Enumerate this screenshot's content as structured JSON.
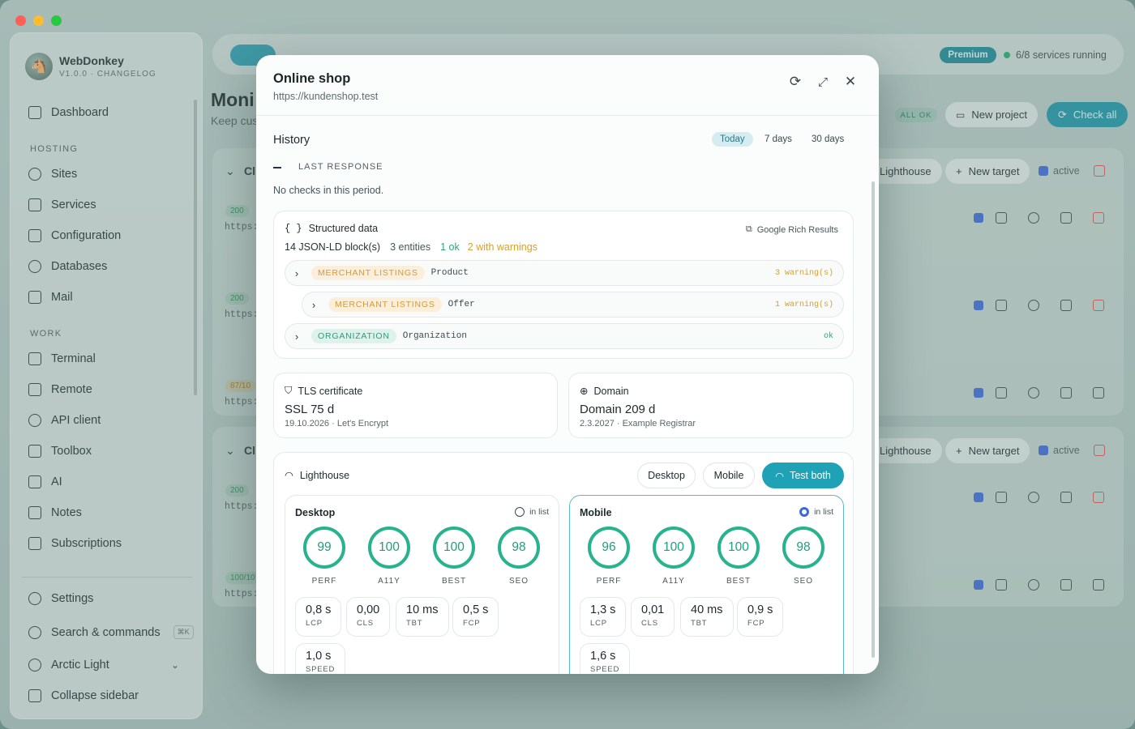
{
  "sidebar": {
    "app_name": "WebDonkey",
    "version": "V1.0.0 · CHANGELOG",
    "dashboard": "Dashboard",
    "section_hosting": "HOSTING",
    "hosting": [
      "Sites",
      "Services",
      "Configuration",
      "Databases",
      "Mail"
    ],
    "section_work": "WORK",
    "work": [
      "Terminal",
      "Remote",
      "API client",
      "Toolbox",
      "AI",
      "Notes",
      "Subscriptions"
    ],
    "settings": "Settings",
    "search": "Search & commands",
    "search_kbd": "⌘K",
    "theme": "Arctic Light",
    "collapse": "Collapse sidebar"
  },
  "background": {
    "title_fragment": "Moni",
    "sub_fragment": "Keep cus",
    "premium": "Premium",
    "running": "6/8 services running",
    "all_ok": "ALL OK",
    "new_project": "New project",
    "check_all": "Check all",
    "lighthouse": "Lighthouse",
    "new_target": "New target",
    "active": "active",
    "statuses": [
      "200",
      "200",
      "87/10",
      "200",
      "100/10"
    ],
    "url_fragment": "https:",
    "group_fragment": "Cl"
  },
  "modal": {
    "title": "Online shop",
    "url": "https://kundenshop.test",
    "history": {
      "title": "History",
      "ranges": [
        "Today",
        "7 days",
        "30 days"
      ],
      "active_range": "Today",
      "last_response_label": "LAST RESPONSE",
      "no_checks": "No checks in this period."
    },
    "structured": {
      "title": "Structured data",
      "icon": "{ }",
      "link": "Google Rich Results",
      "blocks": "14 JSON-LD block(s)",
      "entities": "3 entities",
      "ok": "1 ok",
      "warnings": "2 with warnings",
      "rows": [
        {
          "tag": "MERCHANT LISTINGS",
          "type": "Product",
          "status": "3 warning(s)"
        },
        {
          "tag": "MERCHANT LISTINGS",
          "type": "Offer",
          "status": "1 warning(s)"
        },
        {
          "tag": "ORGANIZATION",
          "type": "Organization",
          "status": "ok"
        }
      ]
    },
    "tls": {
      "title": "TLS certificate",
      "value": "SSL 75 d",
      "sub": "19.10.2026 · Let's Encrypt"
    },
    "domain": {
      "title": "Domain",
      "value": "Domain 209 d",
      "sub": "2.3.2027 · Example Registrar"
    },
    "lighthouse": {
      "title": "Lighthouse",
      "btn_desktop": "Desktop",
      "btn_mobile": "Mobile",
      "btn_both": "Test both",
      "in_list": "in list",
      "desktop": {
        "name": "Desktop",
        "scores": [
          {
            "label": "PERF",
            "value": "99"
          },
          {
            "label": "A11Y",
            "value": "100"
          },
          {
            "label": "BEST",
            "value": "100"
          },
          {
            "label": "SEO",
            "value": "98"
          }
        ],
        "metrics": [
          {
            "v": "0,8 s",
            "k": "LCP"
          },
          {
            "v": "0,00",
            "k": "CLS"
          },
          {
            "v": "10 ms",
            "k": "TBT"
          },
          {
            "v": "0,5 s",
            "k": "FCP"
          },
          {
            "v": "1,0 s",
            "k": "SPEED"
          }
        ]
      },
      "mobile": {
        "name": "Mobile",
        "scores": [
          {
            "label": "PERF",
            "value": "96"
          },
          {
            "label": "A11Y",
            "value": "100"
          },
          {
            "label": "BEST",
            "value": "100"
          },
          {
            "label": "SEO",
            "value": "98"
          }
        ],
        "metrics": [
          {
            "v": "1,3 s",
            "k": "LCP"
          },
          {
            "v": "0,01",
            "k": "CLS"
          },
          {
            "v": "40 ms",
            "k": "TBT"
          },
          {
            "v": "0,9 s",
            "k": "FCP"
          },
          {
            "v": "1,6 s",
            "k": "SPEED"
          }
        ]
      }
    }
  },
  "colors": {
    "accent": "#1fa2b6",
    "ok": "#2aa57d",
    "warn": "#d4a132",
    "gauge": "#28b28e"
  }
}
